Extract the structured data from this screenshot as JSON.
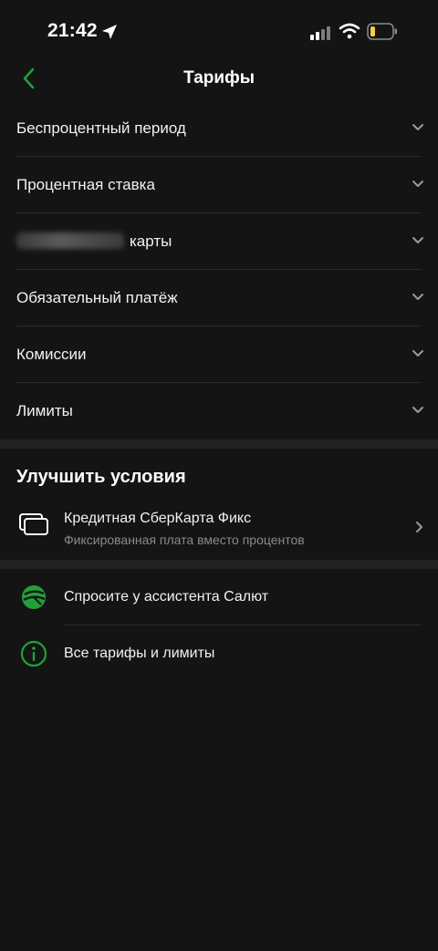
{
  "status": {
    "time": "21:42"
  },
  "header": {
    "title": "Тарифы"
  },
  "accordion": {
    "items": [
      {
        "label": "Беспроцентный период"
      },
      {
        "label": "Процентная ставка"
      },
      {
        "label": "карты"
      },
      {
        "label": "Обязательный платёж"
      },
      {
        "label": "Комиссии"
      },
      {
        "label": "Лимиты"
      }
    ]
  },
  "improve": {
    "title": "Улучшить условия",
    "card": {
      "title": "Кредитная СберКарта Фикс",
      "subtitle": "Фиксированная плата вместо процентов"
    }
  },
  "help": {
    "items": [
      {
        "label": "Спросите у ассистента Салют"
      },
      {
        "label": "Все тарифы и лимиты"
      }
    ]
  },
  "colors": {
    "background": "#141414",
    "accent": "#21a038",
    "divider": "#2a2a2a",
    "secondary_text": "#8a8a8a"
  },
  "icons": {
    "back": "chevron-left-icon",
    "expand": "chevron-down-icon",
    "card": "card-stack-icon",
    "assistant": "salut-assistant-icon",
    "info": "info-icon"
  }
}
